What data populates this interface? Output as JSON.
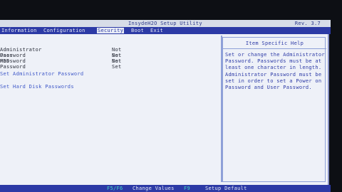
{
  "header": {
    "title": "InsydeH2O Setup Utility",
    "rev": "Rev. 3.7"
  },
  "menu": {
    "tabs": [
      {
        "label": "Information"
      },
      {
        "label": "Configuration"
      },
      {
        "label": "Security"
      },
      {
        "label": "Boot"
      },
      {
        "label": "Exit"
      }
    ],
    "active": "Security"
  },
  "security": {
    "rows": [
      {
        "label": "Administrator Password",
        "value": "Not Set"
      },
      {
        "label": "User Password",
        "value": "Not Set"
      },
      {
        "label": "HDD Password",
        "value": "Not Set"
      }
    ],
    "actions": [
      {
        "label": "Set Administrator Password"
      },
      {
        "label": "Set Hard Disk Passwords"
      }
    ]
  },
  "help": {
    "title": "Item Specific Help",
    "text": "Set or change the Administrator Password. Passwords must be at least one character in length.\nAdministrator Password must be set in order to set a Power on Password and User Password."
  },
  "footer": {
    "items": [
      {
        "key": "F5/F6",
        "label": "Change Values"
      },
      {
        "key": "F9",
        "label": "Setup Default"
      }
    ]
  }
}
